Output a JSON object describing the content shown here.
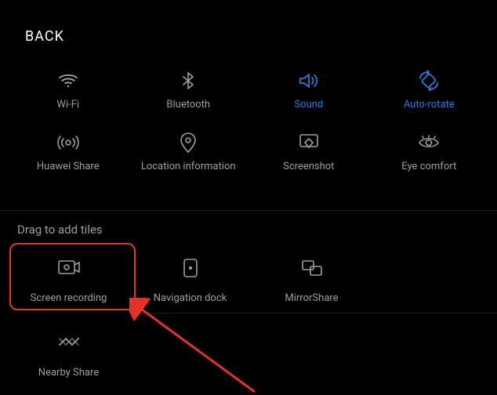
{
  "header": {
    "back": "BACK"
  },
  "section_title": "Drag to add tiles",
  "colors": {
    "on": "#2a7bd6",
    "off": "#9e9e9e",
    "highlight": "#e53229"
  },
  "active_row1": [
    {
      "key": "wifi",
      "label": "Wi-Fi",
      "on": false
    },
    {
      "key": "bluetooth",
      "label": "Bluetooth",
      "on": false
    },
    {
      "key": "sound",
      "label": "Sound",
      "on": true
    },
    {
      "key": "autorotate",
      "label": "Auto-rotate",
      "on": true
    }
  ],
  "active_row2": [
    {
      "key": "huaweishare",
      "label": "Huawei Share",
      "on": false
    },
    {
      "key": "location",
      "label": "Location information",
      "on": false
    },
    {
      "key": "screenshot",
      "label": "Screenshot",
      "on": false
    },
    {
      "key": "eyecomfort",
      "label": "Eye comfort",
      "on": false
    }
  ],
  "inactive_row1": [
    {
      "key": "screenrecording",
      "label": "Screen recording",
      "highlighted": true
    },
    {
      "key": "navdock",
      "label": "Navigation dock"
    },
    {
      "key": "mirrorshare",
      "label": "MirrorShare"
    }
  ],
  "inactive_row2": [
    {
      "key": "nearbyshare",
      "label": "Nearby Share"
    }
  ]
}
